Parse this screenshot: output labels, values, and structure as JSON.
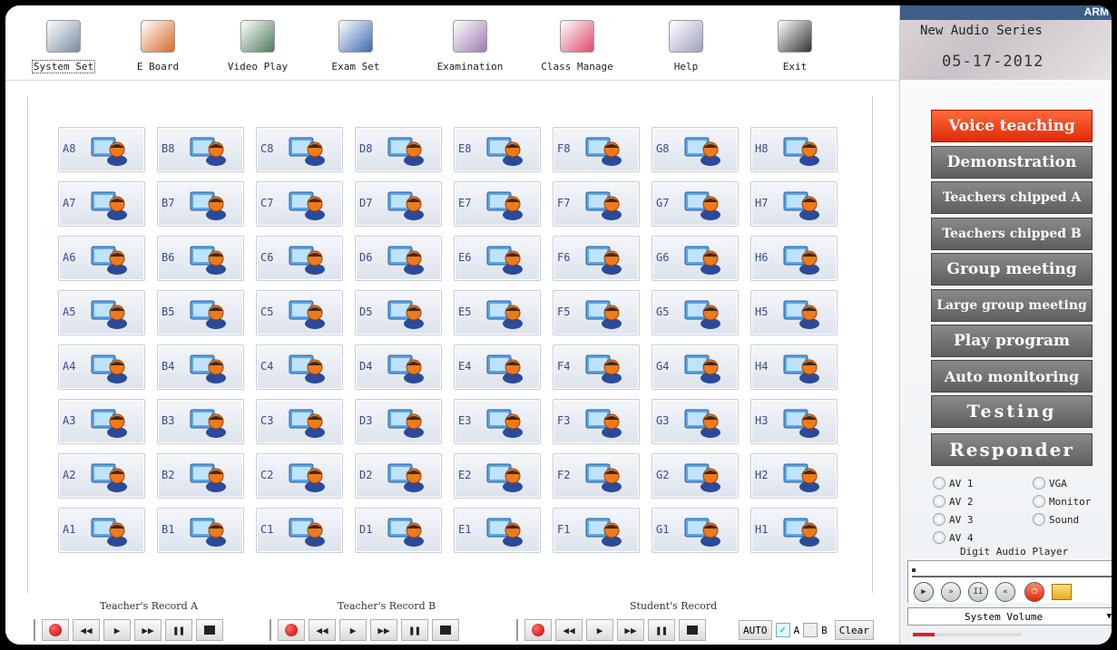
{
  "toolbar": {
    "items": [
      {
        "label": "System Set",
        "icon": "gear-icon",
        "selected": true
      },
      {
        "label": "E Board",
        "icon": "eboard-icon",
        "selected": false
      },
      {
        "label": "Video Play",
        "icon": "video-film-icon",
        "selected": false
      },
      {
        "label": "Exam Set",
        "icon": "document-icon",
        "selected": false
      },
      {
        "label": "Examination",
        "icon": "people-icon",
        "selected": false
      },
      {
        "label": "Class Manage",
        "icon": "palette-icon",
        "selected": false
      },
      {
        "label": "Help",
        "icon": "help-bubble-icon",
        "selected": false
      },
      {
        "label": "Exit",
        "icon": "monitor-icon",
        "selected": false
      }
    ]
  },
  "seats": {
    "columns": [
      "A",
      "B",
      "C",
      "D",
      "E",
      "F",
      "G",
      "H"
    ],
    "rows": [
      8,
      7,
      6,
      5,
      4,
      3,
      2,
      1
    ],
    "icon": "student-pc-icon"
  },
  "recorders": {
    "teacher_a": "Teacher's Record A",
    "teacher_b": "Teacher's Record B",
    "student": "Student's Record",
    "auto_label": "AUTO",
    "a_label": "A",
    "b_label": "B",
    "clear_label": "Clear",
    "a_checked": true,
    "b_checked": false
  },
  "banner": {
    "brand": "ARM",
    "title": "New Audio Series",
    "date": "05-17-2012"
  },
  "modes": [
    {
      "label": "Voice teaching",
      "active": true
    },
    {
      "label": "Demonstration",
      "active": false
    },
    {
      "label": "Teachers chipped A",
      "active": false
    },
    {
      "label": "Teachers chipped B",
      "active": false
    },
    {
      "label": "Group meeting",
      "active": false
    },
    {
      "label": "Large group meeting",
      "active": false
    },
    {
      "label": "Play program",
      "active": false
    },
    {
      "label": "Auto monitoring",
      "active": false
    },
    {
      "label": "Testing",
      "active": false
    },
    {
      "label": "Responder",
      "active": false
    }
  ],
  "sources": {
    "left": [
      "AV 1",
      "AV 2",
      "AV 3",
      "AV 4"
    ],
    "right": [
      "VGA",
      "Monitor",
      "Sound"
    ]
  },
  "player": {
    "title": "Digit Audio Player",
    "volume_label": "System Volume",
    "volume_level": 0.2
  },
  "colors": {
    "active_mode": "#e8401a",
    "mode": "#666666",
    "record": "#cc0000",
    "seat_label": "#3a4a8c"
  }
}
